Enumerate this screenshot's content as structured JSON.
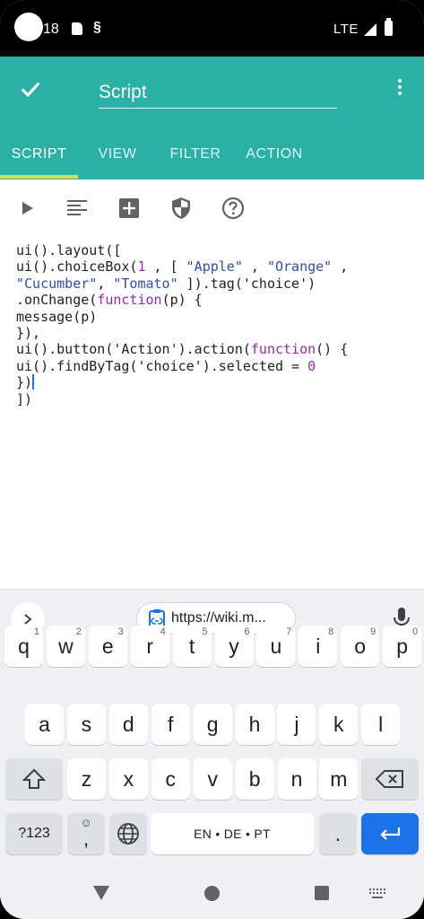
{
  "status_bar": {
    "time": "18",
    "network": "LTE"
  },
  "toolbar": {
    "title": "Script"
  },
  "tabs": [
    {
      "label": "SCRIPT",
      "active": true
    },
    {
      "label": "VIEW",
      "active": false
    },
    {
      "label": "FILTER",
      "active": false
    },
    {
      "label": "ACTION",
      "active": false
    }
  ],
  "code_lines": [
    "ui().layout([",
    "ui().choiceBox(1 , [ \"Apple\" , \"Orange\" ,",
    "\"Cucumber\", \"Tomato\" ]).tag('choice')",
    ".onChange(function(p) {",
    "message(p)",
    "}),",
    "ui().button('Action').action(function() {",
    "ui().findByTag('choice').selected = 0",
    "})",
    "])"
  ],
  "keyboard": {
    "clipboard_chip": "https://wiki.m...",
    "row1": [
      {
        "key": "q",
        "hint": "1"
      },
      {
        "key": "w",
        "hint": "2"
      },
      {
        "key": "e",
        "hint": "3"
      },
      {
        "key": "r",
        "hint": "4"
      },
      {
        "key": "t",
        "hint": "5"
      },
      {
        "key": "y",
        "hint": "6"
      },
      {
        "key": "u",
        "hint": "7"
      },
      {
        "key": "i",
        "hint": "8"
      },
      {
        "key": "o",
        "hint": "9"
      },
      {
        "key": "p",
        "hint": "0"
      }
    ],
    "row2": [
      "a",
      "s",
      "d",
      "f",
      "g",
      "h",
      "j",
      "k",
      "l"
    ],
    "row3": [
      "z",
      "x",
      "c",
      "v",
      "b",
      "n",
      "m"
    ],
    "symbols_label": "?123",
    "comma_label": ",",
    "space_label": "EN • DE • PT",
    "period_label": "."
  },
  "colors": {
    "primary": "#2bb0a6",
    "tab_indicator": "#d4e157",
    "accent_blue": "#1a73e8",
    "keyword": "#9c27b0",
    "string": "#2d4db0"
  }
}
